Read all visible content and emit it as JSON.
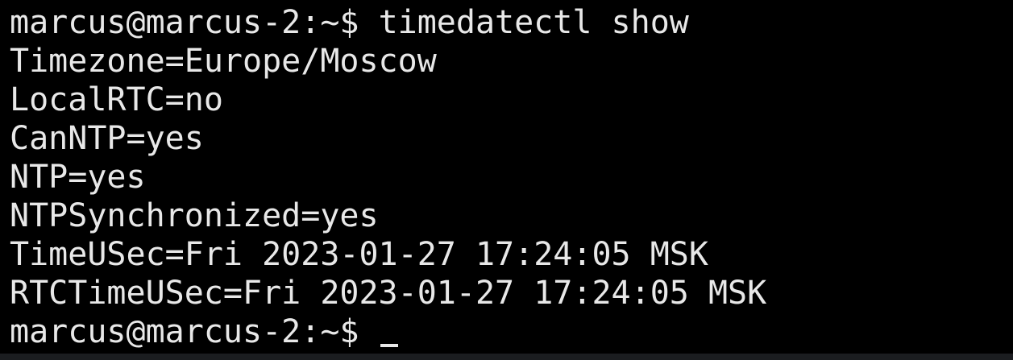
{
  "terminal": {
    "prompt": "marcus@marcus-2:~$ ",
    "command": "timedatectl show",
    "output": [
      "Timezone=Europe/Moscow",
      "LocalRTC=no",
      "CanNTP=yes",
      "NTP=yes",
      "NTPSynchronized=yes",
      "TimeUSec=Fri 2023-01-27 17:24:05 MSK",
      "RTCTimeUSec=Fri 2023-01-27 17:24:05 MSK"
    ],
    "final_prompt": "marcus@marcus-2:~$ "
  },
  "colors": {
    "background": "#000000",
    "foreground": "#e8e8e8"
  }
}
